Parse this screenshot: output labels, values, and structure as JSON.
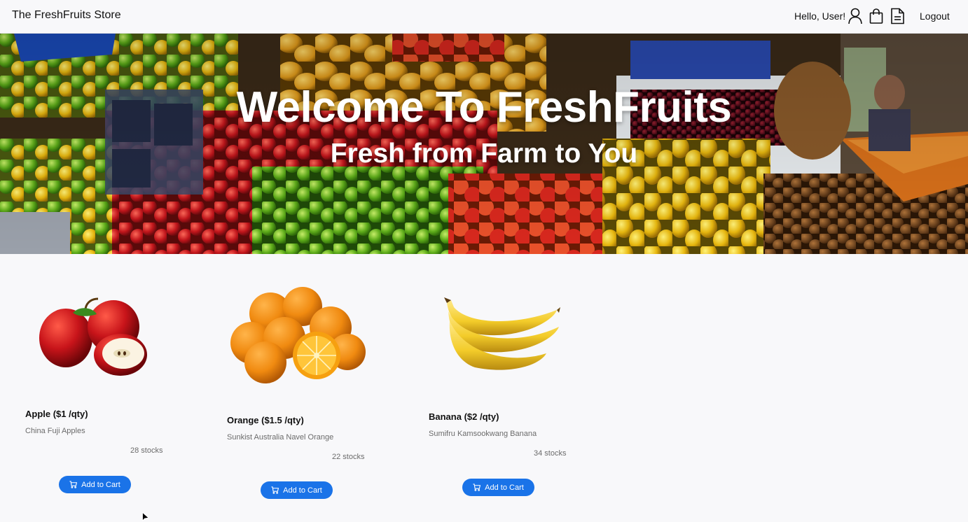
{
  "navbar": {
    "brand": "The FreshFruits Store",
    "greeting": "Hello, User!",
    "icons": [
      "user-icon",
      "shopping-bag-icon",
      "orders-document-icon"
    ],
    "logout": "Logout"
  },
  "hero": {
    "title": "Welcome To FreshFruits",
    "subtitle": "Fresh from Farm to You"
  },
  "products": [
    {
      "name": "Apple ($1 /qty)",
      "description": "China Fuji Apples",
      "stock": "28 stocks",
      "button": "Add to Cart",
      "image": "apple"
    },
    {
      "name": "Orange ($1.5 /qty)",
      "description": "Sunkist Australia Navel Orange",
      "stock": "22 stocks",
      "button": "Add to Cart",
      "image": "orange"
    },
    {
      "name": "Banana ($2 /qty)",
      "description": "Sumifru Kamsookwang Banana",
      "stock": "34 stocks",
      "button": "Add to Cart",
      "image": "banana"
    }
  ],
  "colors": {
    "accent": "#1a73e8",
    "navbar_bg": "#f8f8fa",
    "page_bg": "#f8f8fa"
  }
}
